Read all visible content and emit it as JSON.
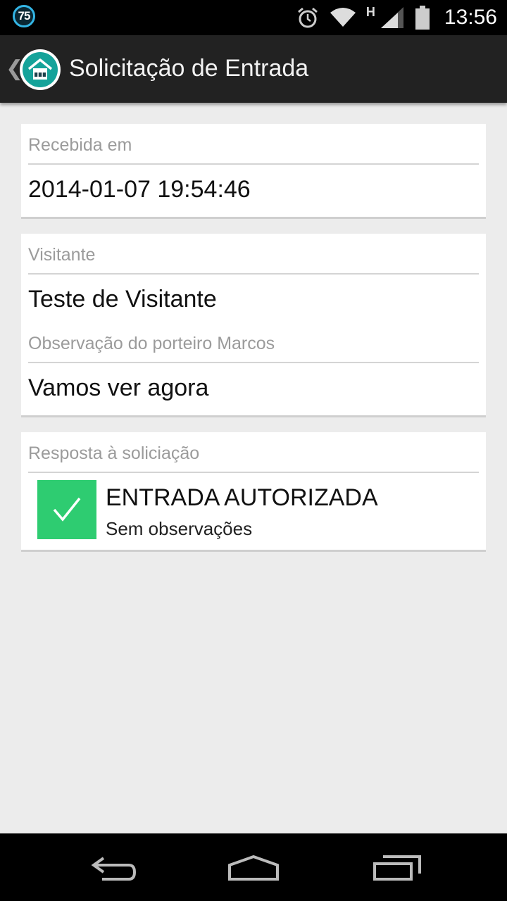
{
  "status_bar": {
    "notification_badge": "75",
    "network_type": "H",
    "time": "13:56",
    "icons": [
      "alarm-icon",
      "wifi-icon",
      "signal-icon",
      "battery-icon"
    ]
  },
  "action_bar": {
    "title": "Solicitação de Entrada",
    "app_icon": "house-icon"
  },
  "received_card": {
    "label": "Recebida em",
    "value": "2014-01-07 19:54:46"
  },
  "visitor_card": {
    "visitor_label": "Visitante",
    "visitor_value": "Teste de Visitante",
    "note_label": "Observação do porteiro Marcos",
    "note_value": "Vamos ver agora"
  },
  "response_card": {
    "label": "Resposta à soliciação",
    "status_title": "ENTRADA AUTORIZADA",
    "status_subtitle": "Sem observações",
    "status_color": "#2ecc71",
    "status_icon": "checkmark-icon"
  },
  "nav_bar": {
    "buttons": [
      "back-icon",
      "home-icon",
      "recents-icon"
    ]
  }
}
